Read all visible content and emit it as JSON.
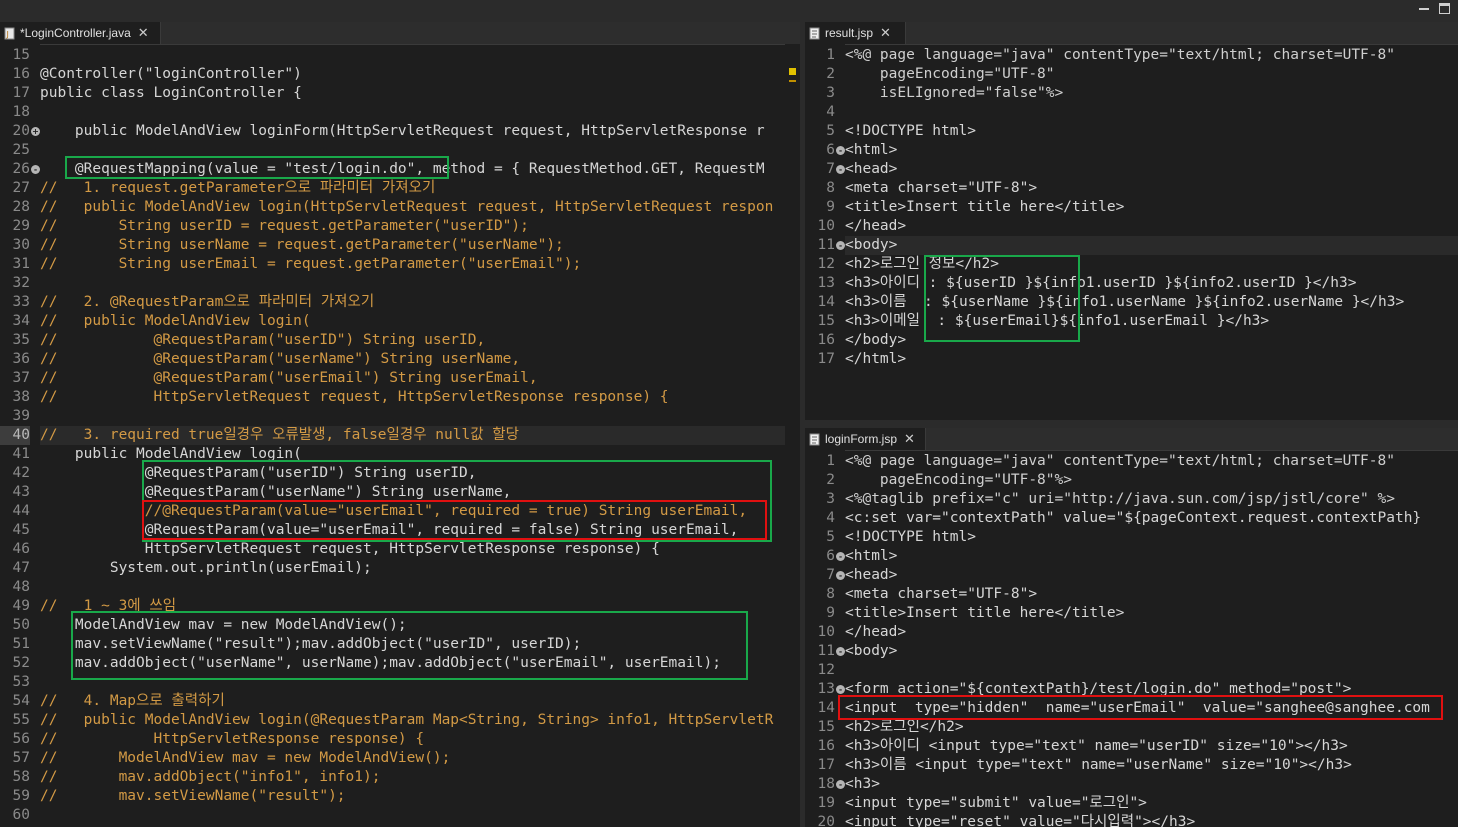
{
  "window": {
    "minimize_label": "minimize",
    "maximize_label": "maximize"
  },
  "left_editor": {
    "tab_title": "*LoginController.java",
    "lines": [
      {
        "n": "15",
        "t": ""
      },
      {
        "n": "16",
        "t": "@Controller(\"loginController\")"
      },
      {
        "n": "17",
        "t": "public class LoginController {"
      },
      {
        "n": "18",
        "t": ""
      },
      {
        "n": "20",
        "t": "    public ModelAndView loginForm(HttpServletRequest request, HttpServletResponse r"
      },
      {
        "n": "25",
        "t": ""
      },
      {
        "n": "26",
        "t": "    @RequestMapping(value = \"test/login.do\", method = { RequestMethod.GET, RequestM"
      },
      {
        "n": "27",
        "t": "//   1. request.getParameter으로 파라미터 가져오기"
      },
      {
        "n": "28",
        "t": "//   public ModelAndView login(HttpServletRequest request, HttpServletRequest respon"
      },
      {
        "n": "29",
        "t": "//       String userID = request.getParameter(\"userID\");"
      },
      {
        "n": "30",
        "t": "//       String userName = request.getParameter(\"userName\");"
      },
      {
        "n": "31",
        "t": "//       String userEmail = request.getParameter(\"userEmail\");"
      },
      {
        "n": "32",
        "t": ""
      },
      {
        "n": "33",
        "t": "//   2. @RequestParam으로 파라미터 가져오기"
      },
      {
        "n": "34",
        "t": "//   public ModelAndView login("
      },
      {
        "n": "35",
        "t": "//           @RequestParam(\"userID\") String userID,"
      },
      {
        "n": "36",
        "t": "//           @RequestParam(\"userName\") String userName,"
      },
      {
        "n": "37",
        "t": "//           @RequestParam(\"userEmail\") String userEmail,"
      },
      {
        "n": "38",
        "t": "//           HttpServletRequest request, HttpServletResponse response) {"
      },
      {
        "n": "39",
        "t": ""
      },
      {
        "n": "40",
        "t": "//   3. required true일경우 오류발생, false일경우 null값 할당"
      },
      {
        "n": "41",
        "t": "    public ModelAndView login("
      },
      {
        "n": "42",
        "t": "            @RequestParam(\"userID\") String userID,"
      },
      {
        "n": "43",
        "t": "            @RequestParam(\"userName\") String userName,"
      },
      {
        "n": "44",
        "t": "            //@RequestParam(value=\"userEmail\", required = true) String userEmail,"
      },
      {
        "n": "45",
        "t": "            @RequestParam(value=\"userEmail\", required = false) String userEmail,"
      },
      {
        "n": "46",
        "t": "            HttpServletRequest request, HttpServletResponse response) {"
      },
      {
        "n": "47",
        "t": "        System.out.println(userEmail);"
      },
      {
        "n": "48",
        "t": ""
      },
      {
        "n": "49",
        "t": "//   1 ~ 3에 쓰임"
      },
      {
        "n": "50",
        "t": "    ModelAndView mav = new ModelAndView();"
      },
      {
        "n": "51",
        "t": "    mav.setViewName(\"result\");mav.addObject(\"userID\", userID);"
      },
      {
        "n": "52",
        "t": "    mav.addObject(\"userName\", userName);mav.addObject(\"userEmail\", userEmail);"
      },
      {
        "n": "53",
        "t": ""
      },
      {
        "n": "54",
        "t": "//   4. Map으로 출력하기"
      },
      {
        "n": "55",
        "t": "//   public ModelAndView login(@RequestParam Map<String, String> info1, HttpServletR"
      },
      {
        "n": "56",
        "t": "//           HttpServletResponse response) {"
      },
      {
        "n": "57",
        "t": "//       ModelAndView mav = new ModelAndView();"
      },
      {
        "n": "58",
        "t": "//       mav.addObject(\"info1\", info1);"
      },
      {
        "n": "59",
        "t": "//       mav.setViewName(\"result\");"
      },
      {
        "n": "60",
        "t": ""
      }
    ]
  },
  "result_editor": {
    "tab_title": "result.jsp",
    "lines": [
      {
        "n": "1",
        "t": "<%@ page language=\"java\" contentType=\"text/html; charset=UTF-8\""
      },
      {
        "n": "2",
        "t": "    pageEncoding=\"UTF-8\""
      },
      {
        "n": "3",
        "t": "    isELIgnored=\"false\"%>"
      },
      {
        "n": "4",
        "t": ""
      },
      {
        "n": "5",
        "t": "<!DOCTYPE html>"
      },
      {
        "n": "6",
        "t": "<html>"
      },
      {
        "n": "7",
        "t": "<head>"
      },
      {
        "n": "8",
        "t": "<meta charset=\"UTF-8\">"
      },
      {
        "n": "9",
        "t": "<title>Insert title here</title>"
      },
      {
        "n": "10",
        "t": "</head>"
      },
      {
        "n": "11",
        "t": "<body>"
      },
      {
        "n": "12",
        "t": "<h2>로그인 정보</h2>"
      },
      {
        "n": "13",
        "t": "<h3>아이디 : ${userID }${info1.userID }${info2.userID }</h3>"
      },
      {
        "n": "14",
        "t": "<h3>이름  : ${userName }${info1.userName }${info2.userName }</h3>"
      },
      {
        "n": "15",
        "t": "<h3>이메일  : ${userEmail}${info1.userEmail }</h3>"
      },
      {
        "n": "16",
        "t": "</body>"
      },
      {
        "n": "17",
        "t": "</html>"
      }
    ]
  },
  "form_editor": {
    "tab_title": "loginForm.jsp",
    "lines": [
      {
        "n": "1",
        "t": "<%@ page language=\"java\" contentType=\"text/html; charset=UTF-8\""
      },
      {
        "n": "2",
        "t": "    pageEncoding=\"UTF-8\"%>"
      },
      {
        "n": "3",
        "t": "<%@taglib prefix=\"c\" uri=\"http://java.sun.com/jsp/jstl/core\" %>"
      },
      {
        "n": "4",
        "t": "<c:set var=\"contextPath\" value=\"${pageContext.request.contextPath}"
      },
      {
        "n": "5",
        "t": "<!DOCTYPE html>"
      },
      {
        "n": "6",
        "t": "<html>"
      },
      {
        "n": "7",
        "t": "<head>"
      },
      {
        "n": "8",
        "t": "<meta charset=\"UTF-8\">"
      },
      {
        "n": "9",
        "t": "<title>Insert title here</title>"
      },
      {
        "n": "10",
        "t": "</head>"
      },
      {
        "n": "11",
        "t": "<body>"
      },
      {
        "n": "12",
        "t": ""
      },
      {
        "n": "13",
        "t": "<form action=\"${contextPath}/test/login.do\" method=\"post\">"
      },
      {
        "n": "14",
        "t": "<input  type=\"hidden\"  name=\"userEmail\"  value=\"sanghee@sanghee.com"
      },
      {
        "n": "15",
        "t": "<h2>로그인</h2>"
      },
      {
        "n": "16",
        "t": "<h3>아이디 <input type=\"text\" name=\"userID\" size=\"10\"></h3>"
      },
      {
        "n": "17",
        "t": "<h3>이름 <input type=\"text\" name=\"userName\" size=\"10\"></h3>"
      },
      {
        "n": "18",
        "t": "<h3>"
      },
      {
        "n": "19",
        "t": "<input type=\"submit\" value=\"로그인\">"
      },
      {
        "n": "20",
        "t": "<input type=\"reset\" value=\"다시입력\"></h3>"
      }
    ]
  }
}
